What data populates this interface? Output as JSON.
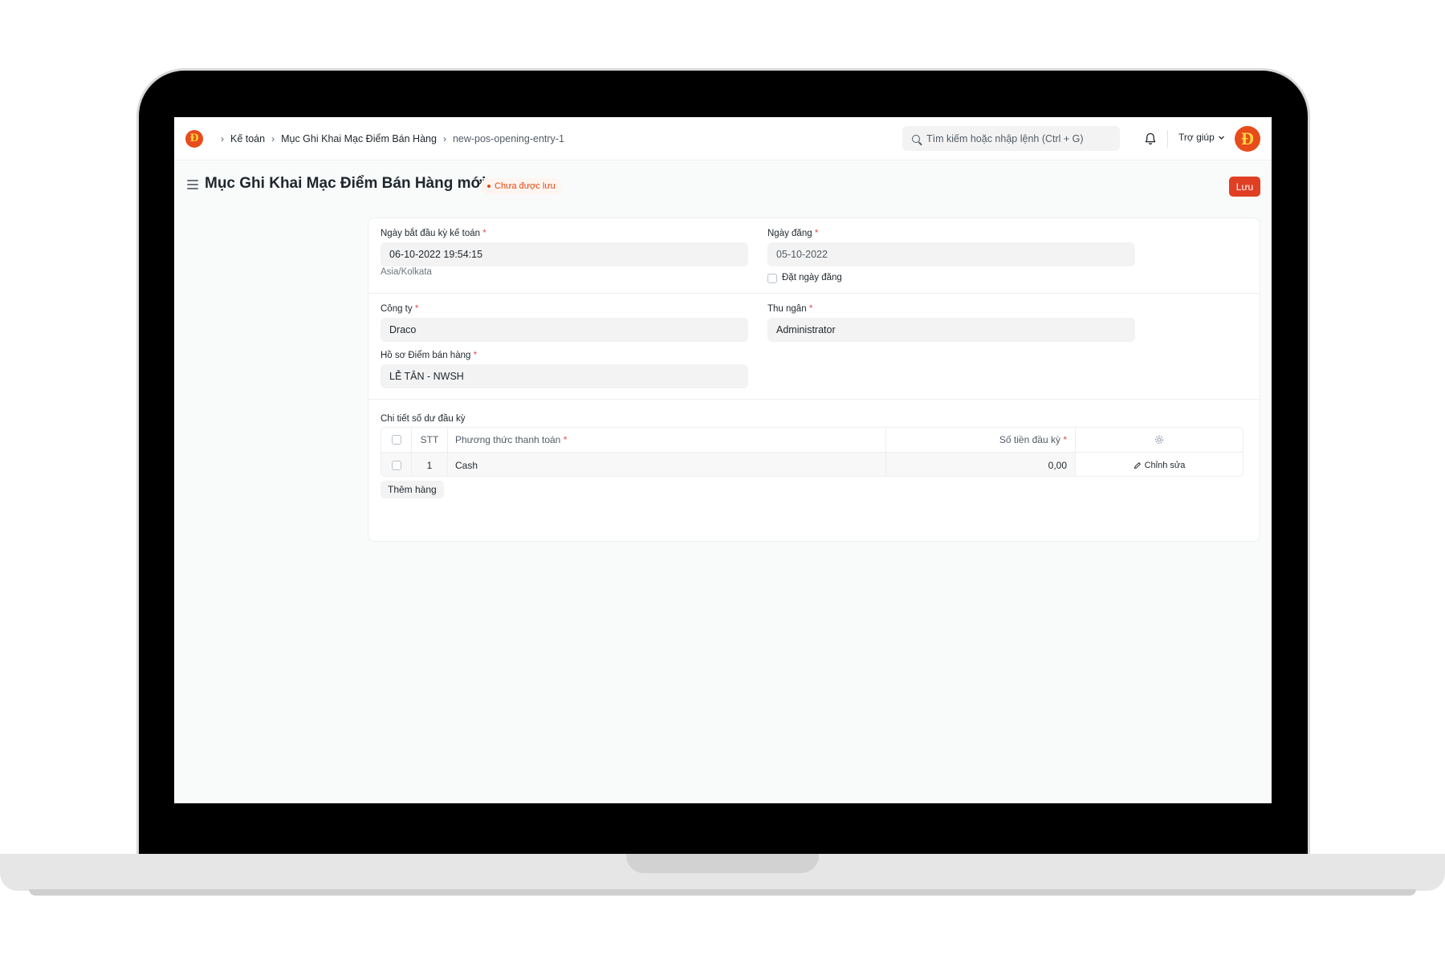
{
  "navbar": {
    "logo_glyph": "Đ",
    "breadcrumbs": [
      "Kế toán",
      "Mục Ghi Khai Mạc Điểm Bán Hàng",
      "new-pos-opening-entry-1"
    ],
    "search_placeholder": "Tìm kiếm hoặc nhập lệnh (Ctrl + G)",
    "help_label": "Trợ giúp",
    "avatar_glyph": "Đ"
  },
  "page": {
    "title": "Mục Ghi Khai Mạc Điểm Bán Hàng mới",
    "status": "Chưa được lưu",
    "save_label": "Lưu"
  },
  "form": {
    "period_start": {
      "label": "Ngày bắt đầu kỳ kế toán",
      "value": "06-10-2022 19:54:15",
      "timezone": "Asia/Kolkata"
    },
    "posting_date": {
      "label": "Ngày đăng",
      "value": "05-10-2022"
    },
    "set_posting_date": {
      "label": "Đặt ngày đăng",
      "checked": false
    },
    "company": {
      "label": "Công ty",
      "value": "Draco"
    },
    "cashier": {
      "label": "Thu ngân",
      "value": "Administrator"
    },
    "pos_profile": {
      "label": "Hồ sơ Điểm bán hàng",
      "value": "LỄ TÂN - NWSH"
    },
    "required_marker": "*"
  },
  "balance_table": {
    "label": "Chi tiết số dư đầu kỳ",
    "columns": {
      "no": "STT",
      "method": "Phương thức thanh toán",
      "amount": "Số tiền đầu kỳ"
    },
    "rows": [
      {
        "no": "1",
        "method": "Cash",
        "amount": "0,00",
        "edit_label": "Chỉnh sửa"
      }
    ],
    "add_row_label": "Thêm hàng"
  },
  "colors": {
    "primary_red": "#e03f24",
    "status_orange": "#e2460d",
    "logo_red": "#e84b1c",
    "logo_yellow": "#ffd83d"
  },
  "icons": [
    "logo",
    "chevron-right-icon",
    "search-icon",
    "bell-icon",
    "chevron-down-icon",
    "hamburger-icon",
    "gear-icon",
    "pencil-icon"
  ]
}
